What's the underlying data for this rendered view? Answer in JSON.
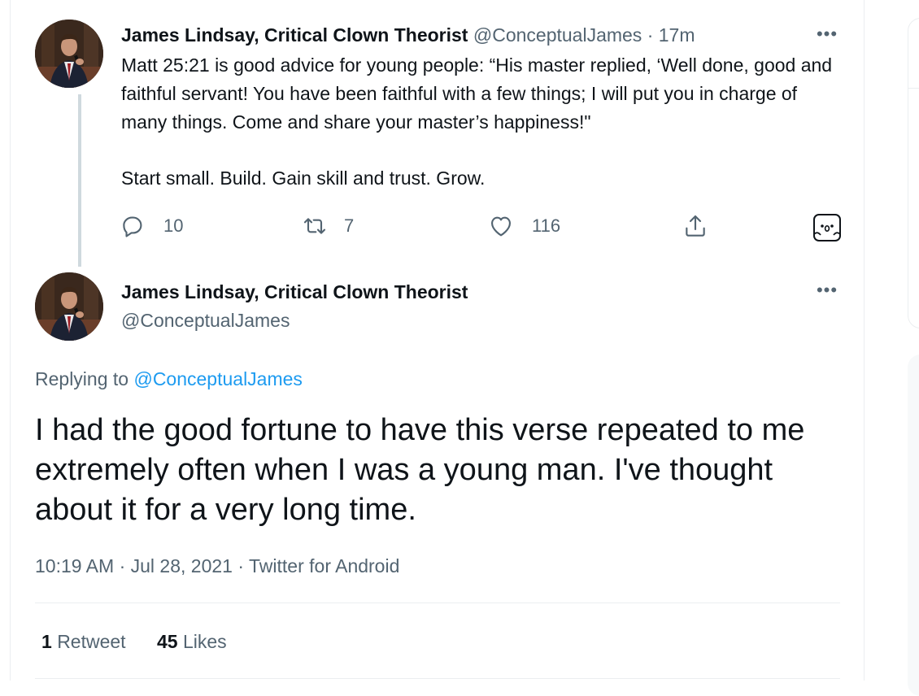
{
  "parent_tweet": {
    "display_name": "James Lindsay, Critical Clown Theorist",
    "handle": "@ConceptualJames",
    "separator": "·",
    "time_ago": "17m",
    "more_icon": "more-horizontal-icon",
    "paragraphs": [
      "Matt 25:21 is good advice for young people: “His master replied, ‘Well done, good and faithful servant! You have been faithful with a few things; I will put you in charge of many things. Come and share your master’s happiness!\"",
      "Start small. Build. Gain skill and trust. Grow."
    ],
    "actions": {
      "reply": {
        "icon": "reply-icon",
        "count": "10"
      },
      "retweet": {
        "icon": "retweet-icon",
        "count": "7"
      },
      "like": {
        "icon": "heart-icon",
        "count": "116"
      },
      "share": {
        "icon": "share-icon"
      },
      "extension": {
        "icon": "ghost-face-icon"
      }
    }
  },
  "focal_tweet": {
    "display_name": "James Lindsay, Critical Clown Theorist",
    "handle": "@ConceptualJames",
    "replying_prefix": "Replying to",
    "replying_to": "@ConceptualJames",
    "text": "I had the good fortune to have this verse repeated to me extremely often when I was a young man. I've thought about it for a very long time.",
    "time": "10:19 AM",
    "separator": "·",
    "date": "Jul 28, 2021",
    "client": "Twitter for Android",
    "stats": {
      "retweets_count": "1",
      "retweets_label": "Retweet",
      "likes_count": "45",
      "likes_label": "Likes"
    }
  },
  "colors": {
    "text_primary": "#0f1419",
    "text_secondary": "#536471",
    "link": "#1d9bf0",
    "border": "#ebeef0",
    "thread_line": "#cfd9de"
  }
}
